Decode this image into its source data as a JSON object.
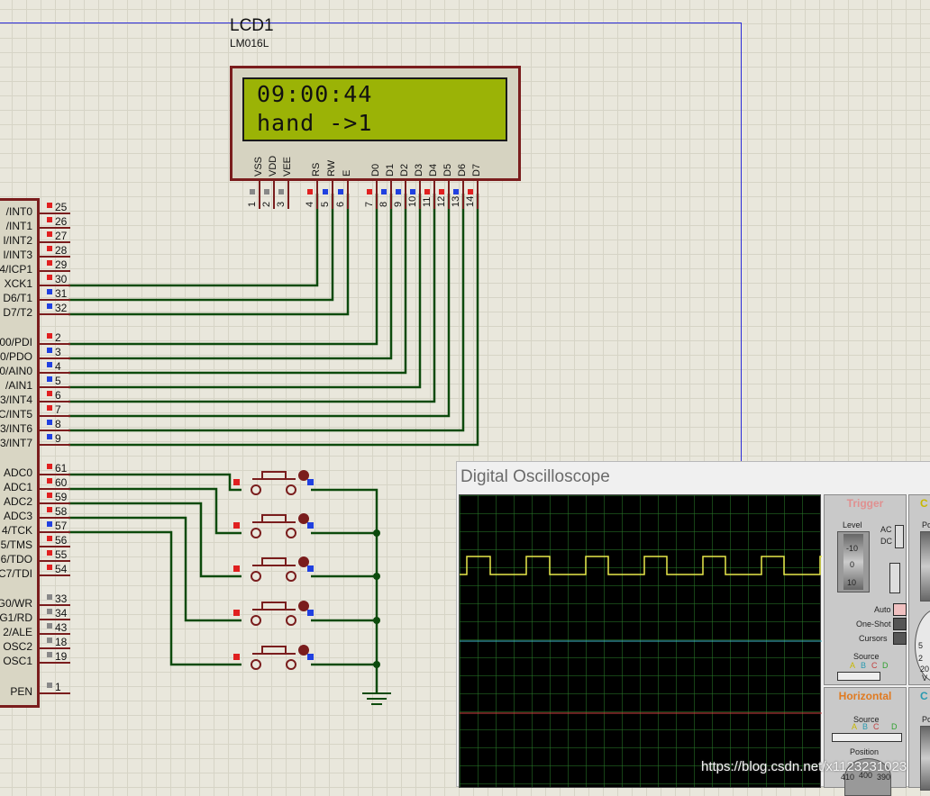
{
  "lcd": {
    "ref": "LCD1",
    "model": "LM016L",
    "line1": "09:00:44",
    "line2": "hand ->1",
    "pins": [
      {
        "name": "VSS",
        "num": "1"
      },
      {
        "name": "VDD",
        "num": "2"
      },
      {
        "name": "VEE",
        "num": "3"
      },
      {
        "name": "RS",
        "num": "4"
      },
      {
        "name": "RW",
        "num": "5"
      },
      {
        "name": "E",
        "num": "6"
      },
      {
        "name": "D0",
        "num": "7"
      },
      {
        "name": "D1",
        "num": "8"
      },
      {
        "name": "D2",
        "num": "9"
      },
      {
        "name": "D3",
        "num": "10"
      },
      {
        "name": "D4",
        "num": "11"
      },
      {
        "name": "D5",
        "num": "12"
      },
      {
        "name": "D6",
        "num": "13"
      },
      {
        "name": "D7",
        "num": "14"
      }
    ]
  },
  "mcu": {
    "pins": [
      {
        "label": "/INT0",
        "num": "25"
      },
      {
        "label": "/INT1",
        "num": "26"
      },
      {
        "label": "I/INT2",
        "num": "27"
      },
      {
        "label": "I/INT3",
        "num": "28"
      },
      {
        "label": "4/ICP1",
        "num": "29"
      },
      {
        "label": "XCK1",
        "num": "30"
      },
      {
        "label": "D6/T1",
        "num": "31"
      },
      {
        "label": "D7/T2",
        "num": "32"
      },
      {
        "label": "00/PDI",
        "num": "2"
      },
      {
        "label": "0/PDO",
        "num": "3"
      },
      {
        "label": "0/AIN0",
        "num": "4"
      },
      {
        "label": "/AIN1",
        "num": "5"
      },
      {
        "label": "3/INT4",
        "num": "6"
      },
      {
        "label": "C/INT5",
        "num": "7"
      },
      {
        "label": "3/INT6",
        "num": "8"
      },
      {
        "label": "3/INT7",
        "num": "9"
      },
      {
        "label": "ADC0",
        "num": "61"
      },
      {
        "label": "ADC1",
        "num": "60"
      },
      {
        "label": "ADC2",
        "num": "59"
      },
      {
        "label": "ADC3",
        "num": "58"
      },
      {
        "label": "4/TCK",
        "num": "57"
      },
      {
        "label": "5/TMS",
        "num": "56"
      },
      {
        "label": "6/TDO",
        "num": "55"
      },
      {
        "label": "C7/TDI",
        "num": "54"
      },
      {
        "label": "G0/WR",
        "num": "33"
      },
      {
        "label": "G1/RD",
        "num": "34"
      },
      {
        "label": "2/ALE",
        "num": "43"
      },
      {
        "label": "OSC2",
        "num": "18"
      },
      {
        "label": "OSC1",
        "num": "19"
      },
      {
        "label": "PEN",
        "num": "1"
      }
    ]
  },
  "oscilloscope": {
    "title": "Digital Oscilloscope",
    "trigger": {
      "heading": "Trigger",
      "level_label": "Level",
      "level_ticks": [
        "-10",
        "0",
        "10"
      ],
      "ac_label": "AC",
      "dc_label": "DC",
      "auto_label": "Auto",
      "oneshot_label": "One-Shot",
      "cursors_label": "Cursors",
      "source_label": "Source",
      "source_channels": [
        "A",
        "B",
        "C",
        "D"
      ]
    },
    "horizontal": {
      "heading": "Horizontal",
      "source_label": "Source",
      "source_channels": [
        "A",
        "B",
        "C",
        "D"
      ],
      "position_label": "Position",
      "position_ticks": [
        "410",
        "400",
        "390"
      ]
    },
    "channel_cut": {
      "heading_c1": "C",
      "heading_c2": "C",
      "pos_label": "Po",
      "dial_ticks": [
        "5",
        "2",
        "20"
      ],
      "dial_unit": "V"
    },
    "colors": {
      "channel_a": "#e8e84a",
      "channel_b": "#3fb8c8",
      "channel_c": "#d04040",
      "grid": "#287828"
    }
  },
  "watermark": "https://blog.csdn.net/x1123231023"
}
